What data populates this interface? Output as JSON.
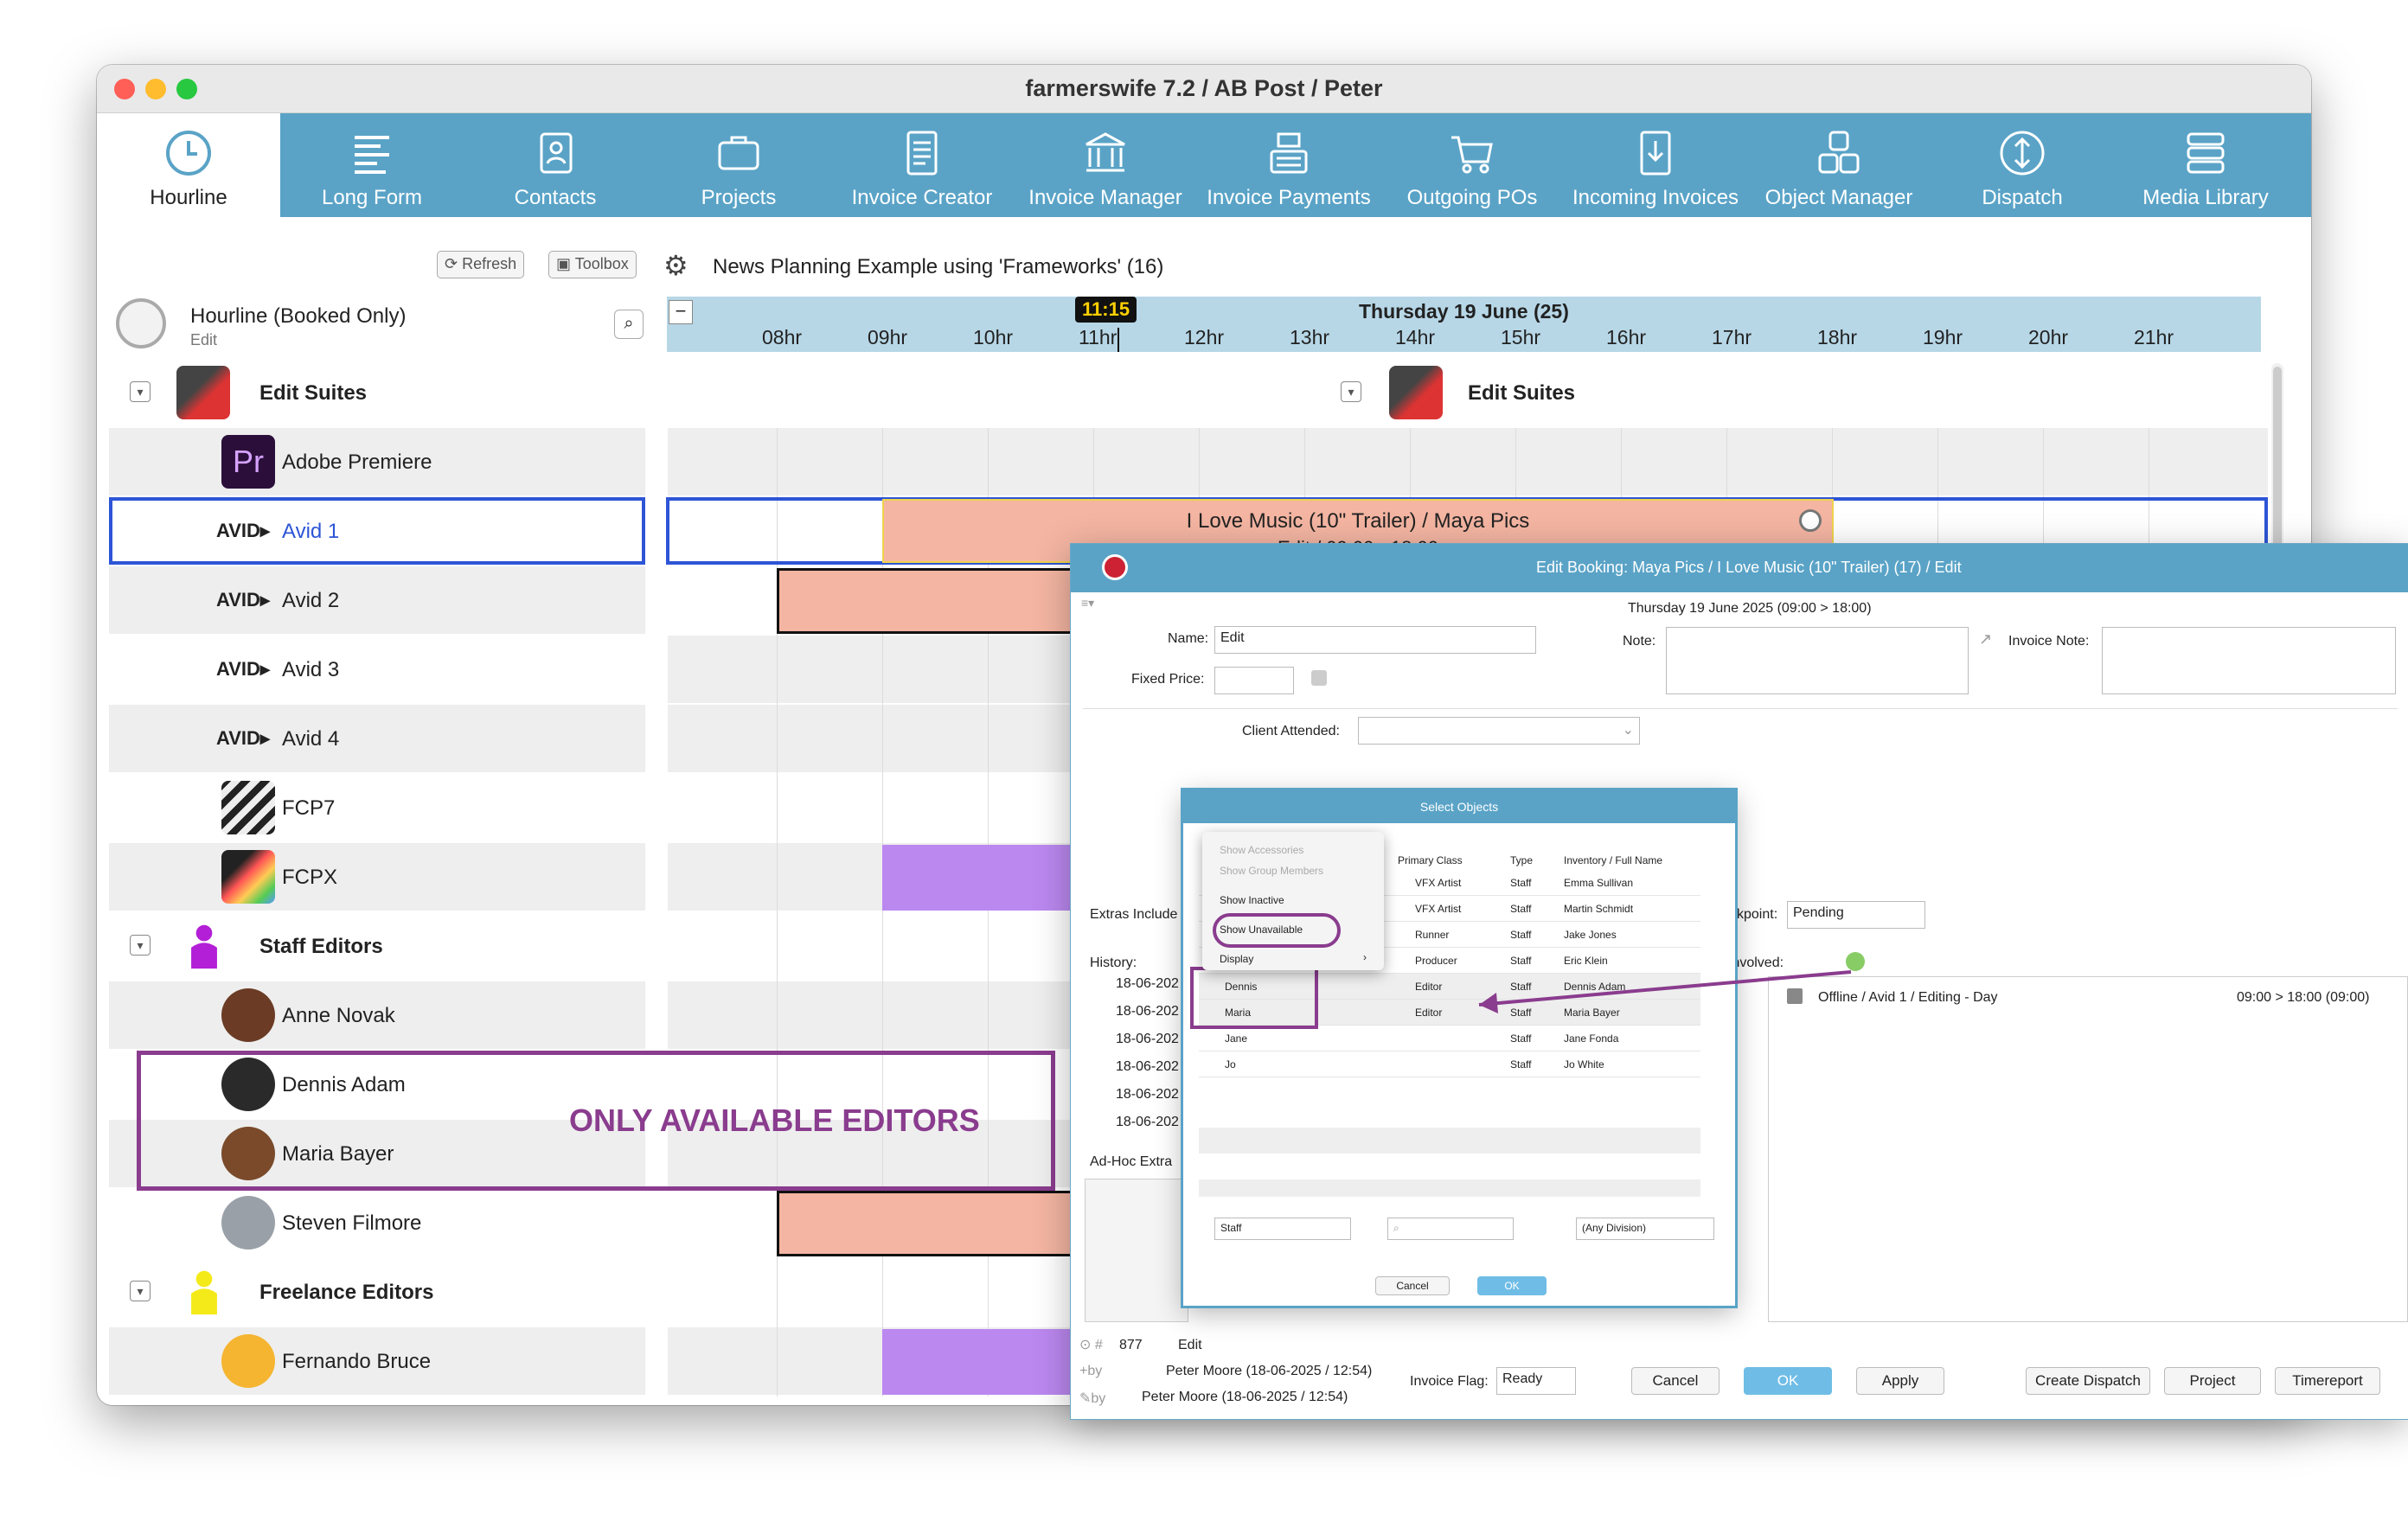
{
  "window": {
    "title": "farmerswife 7.2  / AB Post / Peter"
  },
  "toolbar": [
    {
      "label": "Hourline",
      "icon": "clock-icon",
      "active": true
    },
    {
      "label": "Long Form",
      "icon": "long-form-icon"
    },
    {
      "label": "Contacts",
      "icon": "contacts-icon"
    },
    {
      "label": "Projects",
      "icon": "briefcase-icon"
    },
    {
      "label": "Invoice Creator",
      "icon": "document-icon"
    },
    {
      "label": "Invoice Manager",
      "icon": "bank-icon"
    },
    {
      "label": "Invoice Payments",
      "icon": "cash-register-icon"
    },
    {
      "label": "Outgoing POs",
      "icon": "cart-icon"
    },
    {
      "label": "Incoming Invoices",
      "icon": "download-doc-icon"
    },
    {
      "label": "Object Manager",
      "icon": "objects-icon"
    },
    {
      "label": "Dispatch",
      "icon": "dispatch-icon"
    },
    {
      "label": "Media Library",
      "icon": "server-icon"
    }
  ],
  "controls": {
    "refresh": "Refresh",
    "toolbox": "Toolbox",
    "view_title": "News Planning Example using 'Frameworks' (16)"
  },
  "hourline": {
    "title": "Hourline (Booked Only)",
    "sub": "Edit"
  },
  "timeline": {
    "now": "11:15",
    "date": "Thursday 19 June (25)",
    "hours": [
      "08hr",
      "09hr",
      "10hr",
      "11hr",
      "12hr",
      "13hr",
      "14hr",
      "15hr",
      "16hr",
      "17hr",
      "18hr",
      "19hr",
      "20hr",
      "21hr"
    ]
  },
  "rows": [
    {
      "name": "Edit Suites",
      "group": true
    },
    {
      "name": "Adobe Premiere"
    },
    {
      "name": "Avid 1",
      "selected": true
    },
    {
      "name": "Avid 2"
    },
    {
      "name": "Avid 3"
    },
    {
      "name": "Avid 4"
    },
    {
      "name": "FCP7"
    },
    {
      "name": "FCPX"
    },
    {
      "name": "Staff Editors",
      "group": true
    },
    {
      "name": "Anne Novak"
    },
    {
      "name": "Dennis Adam"
    },
    {
      "name": "Maria Bayer"
    },
    {
      "name": "Steven Filmore"
    },
    {
      "name": "Freelance Editors",
      "group": true
    },
    {
      "name": "Fernando Bruce"
    }
  ],
  "group_header_right": "Edit Suites",
  "booking": {
    "title": "I Love Music (10\" Trailer) / Maya Pics",
    "sub": "Edit / 09:00 - 18:00"
  },
  "annotation": "ONLY AVAILABLE EDITORS",
  "dialog": {
    "title": "Edit Booking: Maya Pics / I Love Music (10\" Trailer) (17) / Edit",
    "date": "Thursday 19 June 2025 (09:00 > 18:00)",
    "name_label": "Name:",
    "name_value": "Edit",
    "note_label": "Note:",
    "invoice_note_label": "Invoice Note:",
    "fixed_price_label": "Fixed Price:",
    "client_attended_label": "Client Attended:",
    "extras_label": "Extras Include",
    "checkpoint_label": "kpoint:",
    "checkpoint_value": "Pending",
    "history_label": "History:",
    "history": [
      "18-06-202",
      "18-06-202",
      "18-06-202",
      "18-06-202",
      "18-06-202",
      "18-06-202"
    ],
    "involved_label": "Involved:",
    "involved_item": "Offline / Avid 1 / Editing - Day",
    "involved_time": "09:00 > 18:00 (09:00)",
    "adhoc_label": "Ad-Hoc Extra",
    "id": "877",
    "id_name": "Edit",
    "created_by": "Peter Moore (18-06-2025 / 12:54)",
    "modified_by": "Peter Moore (18-06-2025 / 12:54)",
    "invoice_flag_label": "Invoice Flag:",
    "invoice_flag_value": "Ready",
    "buttons": [
      "Cancel",
      "OK",
      "Apply",
      "Create Dispatch",
      "Project",
      "Timereport"
    ]
  },
  "select": {
    "title": "Select Objects",
    "headers": [
      "Primary Class",
      "Type",
      "Inventory / Full Name"
    ],
    "rows": [
      {
        "short": "",
        "class": "VFX Artist",
        "type": "Staff",
        "full": "Emma Sullivan"
      },
      {
        "short": "",
        "class": "VFX Artist",
        "type": "Staff",
        "full": "Martin Schmidt"
      },
      {
        "short": "",
        "class": "Runner",
        "type": "Staff",
        "full": "Jake Jones"
      },
      {
        "short": "",
        "class": "Producer",
        "type": "Staff",
        "full": "Eric Klein"
      },
      {
        "short": "Dennis",
        "class": "Editor",
        "type": "Staff",
        "full": "Dennis Adam"
      },
      {
        "short": "Maria",
        "class": "Editor",
        "type": "Staff",
        "full": "Maria Bayer"
      },
      {
        "short": "Jane",
        "class": "",
        "type": "Staff",
        "full": "Jane Fonda"
      },
      {
        "short": "Jo",
        "class": "",
        "type": "Staff",
        "full": "Jo White"
      }
    ],
    "filter_type": "Staff",
    "filter_division": "(Any Division)",
    "cancel": "Cancel",
    "ok": "OK"
  },
  "context_menu": [
    "Show Accessories",
    "Show Group Members",
    "Show Inactive",
    "Show Unavailable",
    "Display"
  ],
  "colors": {
    "toolbar": "#5aa3c7",
    "booking": "#f4b5a2",
    "purple_bar": "#bb88f0",
    "annotation": "#8a3c8e",
    "selected": "#2d55d6"
  }
}
